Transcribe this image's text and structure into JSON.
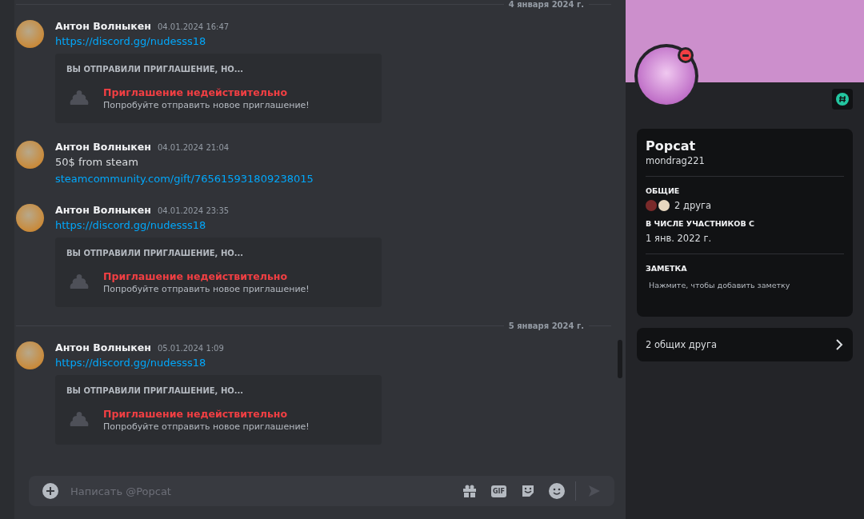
{
  "chat": {
    "feed": [
      {
        "kind": "divider",
        "label": "4 января 2024 г."
      },
      {
        "kind": "message",
        "author": "Антон Волныкен",
        "time": "04.01.2024 16:47",
        "lines": [
          {
            "kind": "link",
            "text": "https://discord.gg/nudesss18"
          }
        ],
        "embed": {
          "header": "ВЫ ОТПРАВИЛИ ПРИГЛАШЕНИЕ, НО...",
          "title": "Приглашение недействительно",
          "subtitle": "Попробуйте отправить новое приглашение!"
        }
      },
      {
        "kind": "message",
        "author": "Антон Волныкен",
        "time": "04.01.2024 21:04",
        "lines": [
          {
            "kind": "text",
            "text": "50$ from steam"
          },
          {
            "kind": "link",
            "text": "steamcommunity.com/gift/765615931809238015"
          }
        ]
      },
      {
        "kind": "message",
        "author": "Антон Волныкен",
        "time": "04.01.2024 23:35",
        "lines": [
          {
            "kind": "link",
            "text": "https://discord.gg/nudesss18"
          }
        ],
        "embed": {
          "header": "ВЫ ОТПРАВИЛИ ПРИГЛАШЕНИЕ, НО...",
          "title": "Приглашение недействительно",
          "subtitle": "Попробуйте отправить новое приглашение!"
        }
      },
      {
        "kind": "divider",
        "label": "5 января 2024 г."
      },
      {
        "kind": "message",
        "author": "Антон Волныкен",
        "time": "05.01.2024 1:09",
        "lines": [
          {
            "kind": "link",
            "text": "https://discord.gg/nudesss18"
          }
        ],
        "embed": {
          "header": "ВЫ ОТПРАВИЛИ ПРИГЛАШЕНИЕ, НО...",
          "title": "Приглашение недействительно",
          "subtitle": "Попробуйте отправить новое приглашение!"
        }
      }
    ],
    "composer": {
      "placeholder": "Написать @Popcat",
      "gif_label": "GIF",
      "send_disabled": true
    }
  },
  "profile": {
    "do_not_disturb": true,
    "display_name": "Popcat",
    "username": "mondrag221",
    "sections": [
      {
        "kind": "mutual",
        "title": "ОБЩИЕ",
        "text": "2 друга"
      },
      {
        "kind": "date",
        "title": "В ЧИСЛЕ УЧАСТНИКОВ С",
        "text": "1 янв. 2022 г."
      },
      {
        "kind": "note",
        "title": "ЗАМЕТКА",
        "placeholder": "Нажмите, чтобы добавить заметку"
      }
    ],
    "mutual_friends_button": "2 общих друга"
  }
}
